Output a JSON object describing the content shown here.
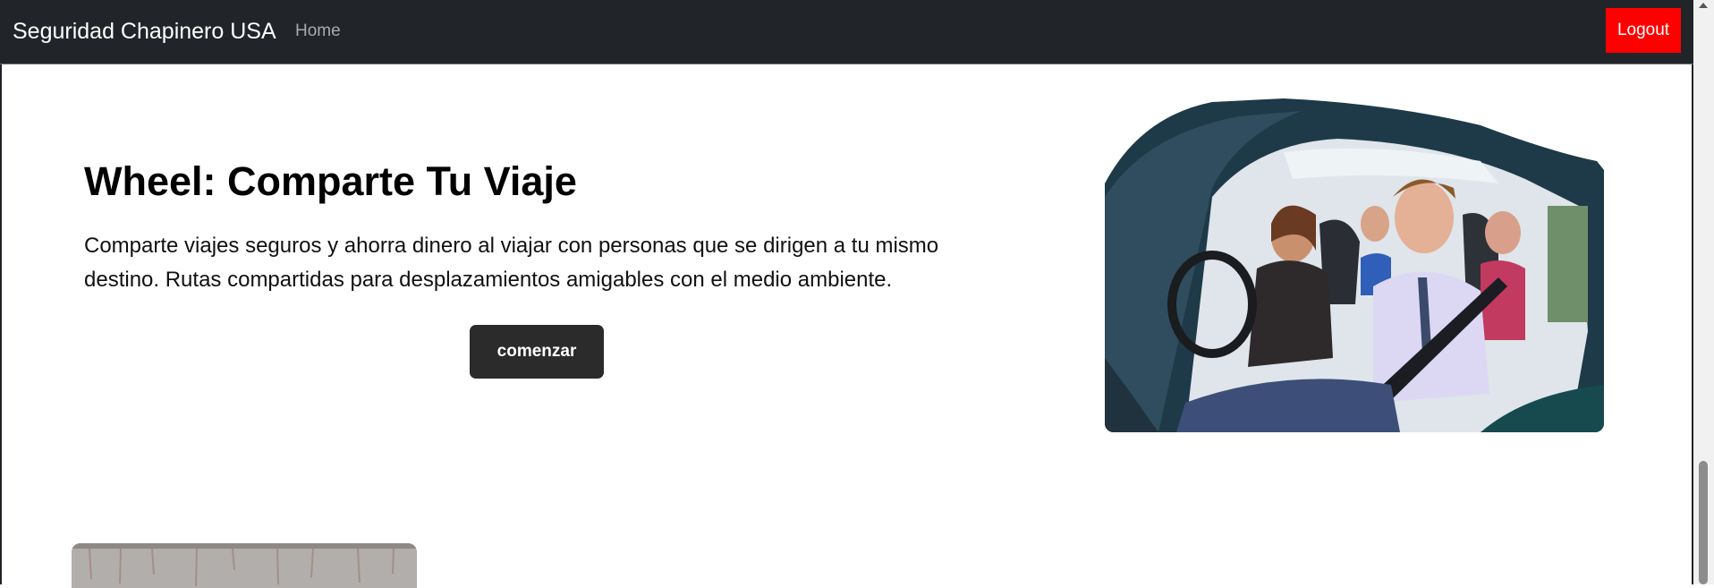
{
  "navbar": {
    "brand": "Seguridad Chapinero USA",
    "home_label": "Home",
    "logout_label": "Logout",
    "logout_color": "#ff0000"
  },
  "hero": {
    "title": "Wheel: Comparte Tu Viaje",
    "description": "Comparte viajes seguros y ahorra dinero al viajar con personas que se dirigen a tu mismo destino. Rutas compartidas para desplazamientos amigables con el medio ambiente.",
    "cta_label": "comenzar"
  }
}
